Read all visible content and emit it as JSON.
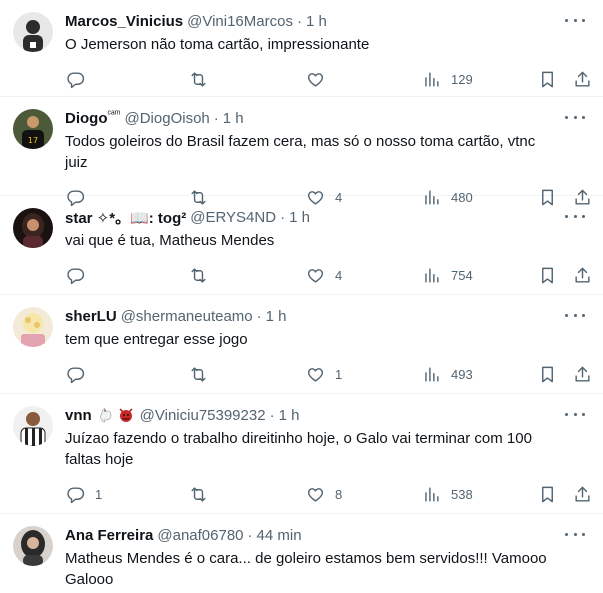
{
  "tweets": [
    {
      "name": "Marcos_Vinicius",
      "handle": "@Vini16Marcos",
      "sep": "·",
      "time": "1 h",
      "text": "O Jemerson não toma cartão, impressionante",
      "replies": "",
      "retweets": "",
      "likes": "",
      "views": "129",
      "avatar_color": "#2c2c2c"
    },
    {
      "name": "Diogo",
      "name_suffix": "ᶜᵃᵐ",
      "handle": "@DiogOisoh",
      "sep": "·",
      "time": "1 h",
      "text": "Todos goleiros do Brasil fazem cera, mas só o nosso toma cartão, vtnc juiz",
      "replies": "",
      "retweets": "",
      "likes": "4",
      "views": "480",
      "avatar_color": "#1b1b1b"
    },
    {
      "name": "star ✧*。📖: tog²",
      "handle": "@ERYS4ND",
      "sep": "·",
      "time": "1 h",
      "text": "vai que é tua, Matheus Mendes",
      "replies": "",
      "retweets": "",
      "likes": "4",
      "views": "754",
      "avatar_color": "#3a2420"
    },
    {
      "name": "sherLU",
      "handle": "@shermaneuteamo",
      "sep": "·",
      "time": "1 h",
      "text": "tem que entregar esse jogo",
      "replies": "",
      "retweets": "",
      "likes": "1",
      "views": "493",
      "avatar_color": "#e9d6c6"
    },
    {
      "name": "vnn",
      "handle": "@Viniciu75399232",
      "sep": "·",
      "time": "1 h",
      "text": "Juízao fazendo o trabalho direitinho hoje, o Galo vai terminar com 100 faltas hoje",
      "replies": "1",
      "retweets": "",
      "likes": "8",
      "views": "538",
      "avatar_color": "#d8d8d8"
    },
    {
      "name": "Ana Ferreira",
      "handle": "@anaf06780",
      "sep": "·",
      "time": "44 min",
      "text": "Matheus Mendes é o cara... de goleiro estamos bem servidos!!! Vamooo Galooo",
      "replies": "",
      "retweets": "",
      "likes": "",
      "views": "",
      "avatar_color": "#2a2a2a"
    }
  ],
  "icons": {
    "reply": "reply-icon",
    "retweet": "retweet-icon",
    "like": "heart-icon",
    "views": "views-icon",
    "bookmark": "bookmark-icon",
    "share": "share-icon",
    "more": "more-icon"
  },
  "colors": {
    "text": "#0f1419",
    "secondary": "#536471",
    "divider": "#eff3f4"
  }
}
